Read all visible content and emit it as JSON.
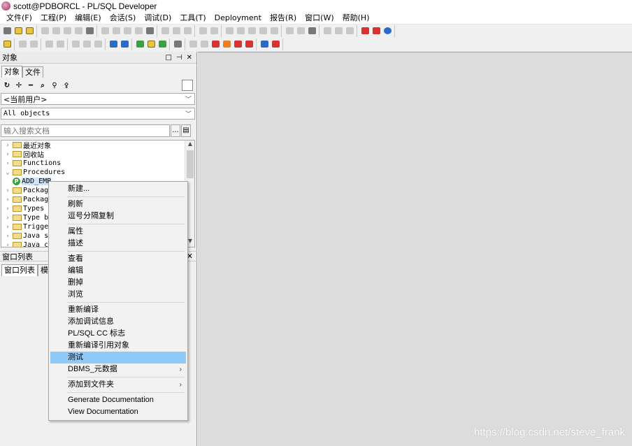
{
  "window": {
    "title": "scott@PDBORCL - PL/SQL Developer",
    "icon": "pl-sql-developer-icon"
  },
  "menubar": {
    "items": [
      "文件(F)",
      "工程(P)",
      "编辑(E)",
      "会话(S)",
      "调试(D)",
      "工具(T)",
      "Deployment",
      "报告(R)",
      "窗口(W)",
      "帮助(H)"
    ]
  },
  "left_panel": {
    "header": "对象",
    "tabs": [
      "对象",
      "文件"
    ],
    "user_select": "<当前用户>",
    "filter_select": "All objects",
    "search_placeholder": "输入搜索文档",
    "search_btn_label": "...",
    "tree": [
      {
        "label": "最近对象",
        "type": "folder",
        "expanded": false
      },
      {
        "label": "回收站",
        "type": "folder",
        "expanded": false
      },
      {
        "label": "Functions",
        "type": "folder",
        "expanded": false
      },
      {
        "label": "Procedures",
        "type": "folder",
        "expanded": true
      },
      {
        "label": "ADD_EMP",
        "type": "procedure",
        "selected": true
      },
      {
        "label": "Package",
        "type": "folder",
        "expanded": false
      },
      {
        "label": "Package",
        "type": "folder",
        "expanded": false
      },
      {
        "label": "Types",
        "type": "folder",
        "expanded": false
      },
      {
        "label": "Type bo",
        "type": "folder",
        "expanded": false
      },
      {
        "label": "Trigger",
        "type": "folder",
        "expanded": false
      },
      {
        "label": "Java so",
        "type": "folder",
        "expanded": false
      },
      {
        "label": "Java cl",
        "type": "folder",
        "expanded": false
      }
    ],
    "window_list_header": "窗口列表",
    "window_list_tabs": [
      "窗口列表",
      "模"
    ]
  },
  "context_menu": {
    "groups": [
      [
        {
          "label": "新建..."
        }
      ],
      [
        {
          "label": "刷新"
        },
        {
          "label": "逗号分隔复制"
        }
      ],
      [
        {
          "label": "属性"
        },
        {
          "label": "描述"
        }
      ],
      [
        {
          "label": "查看"
        },
        {
          "label": "编辑"
        },
        {
          "label": "删掉"
        },
        {
          "label": "浏览"
        }
      ],
      [
        {
          "label": "重新编译"
        },
        {
          "label": "添加调试信息"
        },
        {
          "label": "PL/SQL CC 标志"
        },
        {
          "label": "重新编译引用对象"
        },
        {
          "label": "测试",
          "highlighted": true
        },
        {
          "label": "DBMS_元数据",
          "submenu": true
        }
      ],
      [
        {
          "label": "添加到文件夹",
          "submenu": true
        }
      ],
      [
        {
          "label": "Generate Documentation"
        },
        {
          "label": "View Documentation"
        }
      ]
    ]
  },
  "watermark": "https://blog.csdn.net/steve_frank",
  "colors": {
    "highlight": "#91c9f7",
    "workspace": "#dcdcdc",
    "selection": "#cfe4f8"
  }
}
